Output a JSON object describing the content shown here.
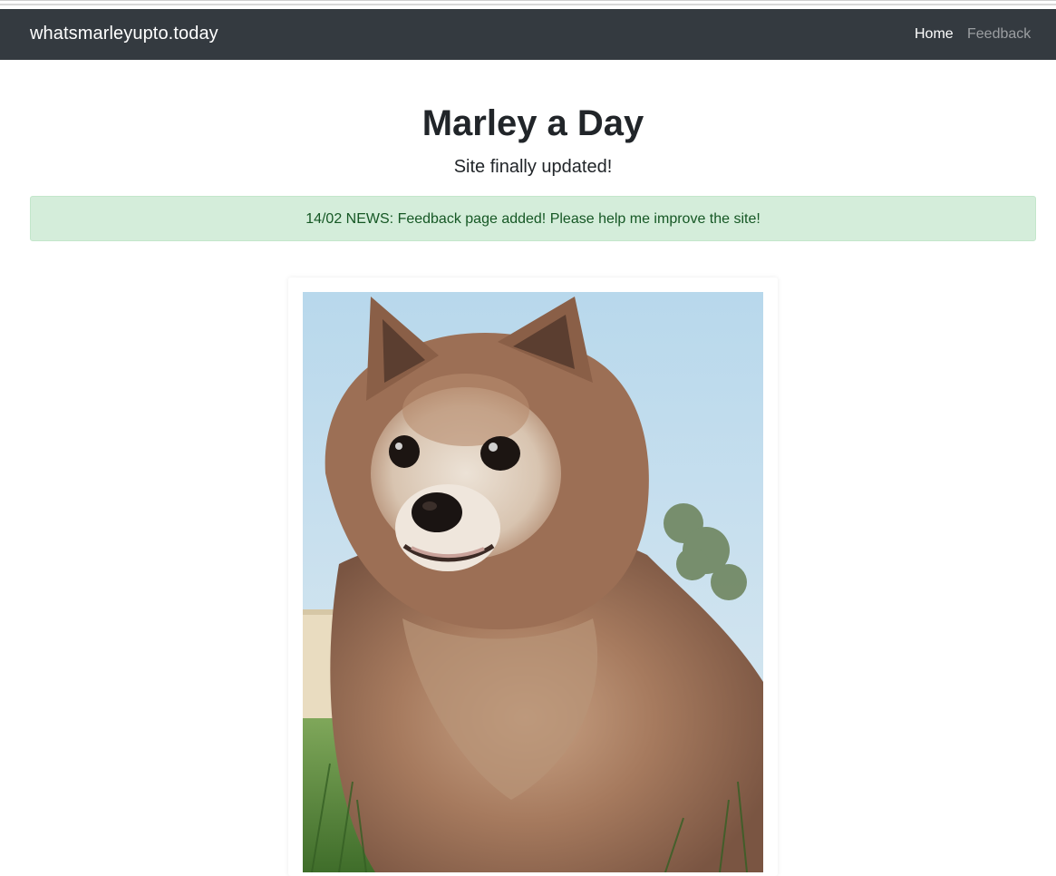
{
  "navbar": {
    "brand": "whatsmarleyupto.today",
    "links": [
      {
        "label": "Home",
        "active": true
      },
      {
        "label": "Feedback",
        "active": false
      }
    ],
    "background": "#343a40"
  },
  "main": {
    "title": "Marley a Day",
    "subtitle": "Site finally updated!",
    "alert": {
      "text": "14/02 NEWS: Feedback page added! Please help me improve the site!",
      "background": "#d4edda",
      "color": "#155724"
    },
    "photo": {
      "subject": "pomeranian-dog-photo"
    }
  }
}
